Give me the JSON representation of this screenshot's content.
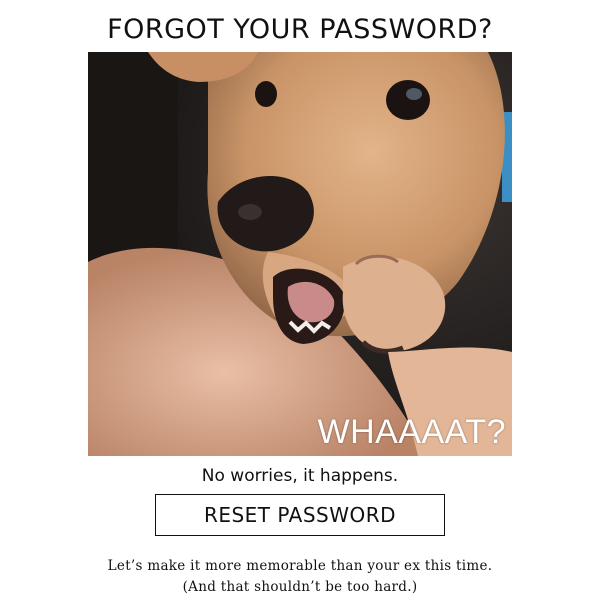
{
  "headline": "FORGOT YOUR PASSWORD?",
  "hero": {
    "icon": "surprised-dog-photo",
    "caption": "WHAAAAT?"
  },
  "reassurance": "No worries, it happens.",
  "reset_button_label": "RESET PASSWORD",
  "footnote": {
    "line1": "Let’s make it more memorable than your ex this time.",
    "line2": "(And that shouldn’t be too hard.)"
  },
  "colors": {
    "text": "#111111",
    "background": "#ffffff",
    "button_border": "#111111"
  }
}
